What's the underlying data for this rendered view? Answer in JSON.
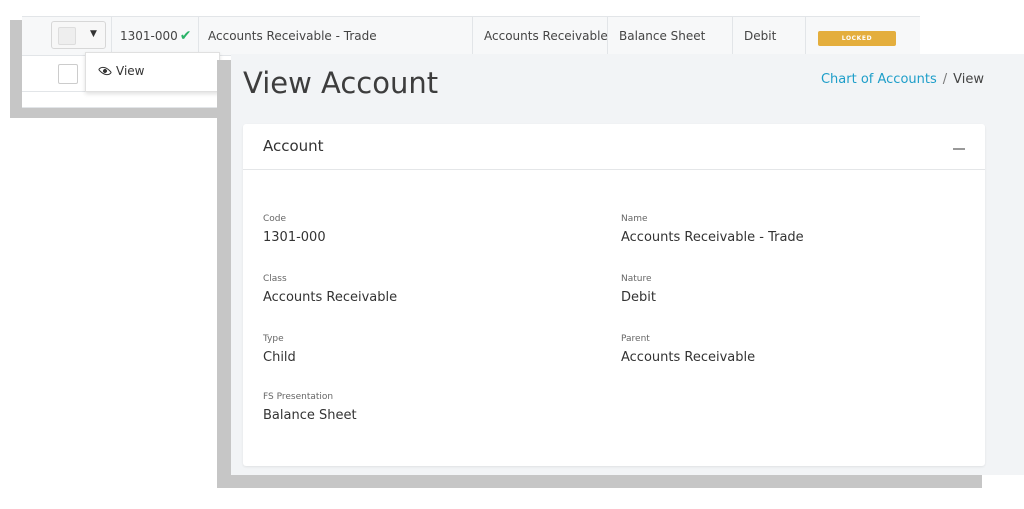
{
  "table_row": {
    "code": "1301-000",
    "name": "Accounts Receivable - Trade",
    "class": "Accounts Receivable",
    "fs_presentation": "Balance Sheet",
    "nature": "Debit",
    "status": "LOCKED"
  },
  "row_menu": {
    "view_label": "View"
  },
  "page": {
    "title": "View Account",
    "breadcrumb": {
      "link": "Chart of Accounts",
      "separator": "/",
      "current": "View"
    }
  },
  "card": {
    "title": "Account",
    "fields": {
      "code": {
        "label": "Code",
        "value": "1301-000"
      },
      "name": {
        "label": "Name",
        "value": "Accounts Receivable - Trade"
      },
      "class": {
        "label": "Class",
        "value": "Accounts Receivable"
      },
      "nature": {
        "label": "Nature",
        "value": "Debit"
      },
      "type": {
        "label": "Type",
        "value": "Child"
      },
      "parent": {
        "label": "Parent",
        "value": "Accounts Receivable"
      },
      "fs_presentation": {
        "label": "FS Presentation",
        "value": "Balance Sheet"
      }
    }
  },
  "colors": {
    "link": "#1e9ec9",
    "locked_badge": "#e4ae3d",
    "check": "#2ab368"
  },
  "icons": [
    "check-icon",
    "eye-icon",
    "caret-down-icon",
    "collapse-icon"
  ]
}
